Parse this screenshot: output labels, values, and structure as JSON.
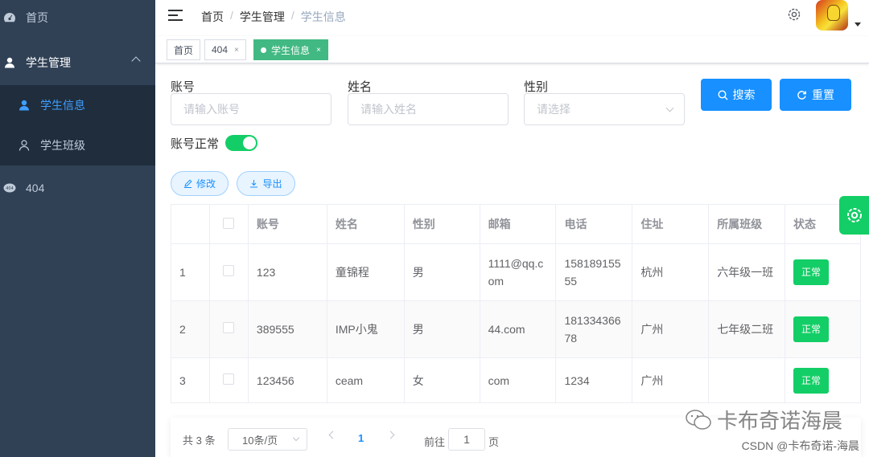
{
  "sidebar": {
    "home": "首页",
    "student_mgmt": "学生管理",
    "student_info": "学生信息",
    "student_class": "学生班级",
    "not_found": "404"
  },
  "navbar": {
    "breadcrumb": [
      "首页",
      "学生管理",
      "学生信息"
    ],
    "sep": "/"
  },
  "tags": {
    "home": "首页",
    "not_found": "404",
    "current": "学生信息",
    "close": "×"
  },
  "search": {
    "account_label": "账号",
    "account_placeholder": "请输入账号",
    "name_label": "姓名",
    "name_placeholder": "请输入姓名",
    "gender_label": "性别",
    "gender_placeholder": "请选择",
    "status_label": "账号正常",
    "status_on": true,
    "search_button": "搜索",
    "reset_button": "重置"
  },
  "actions": {
    "edit": "修改",
    "export": "导出"
  },
  "table": {
    "headers": [
      "账号",
      "姓名",
      "性别",
      "邮箱",
      "电话",
      "住址",
      "所属班级",
      "状态"
    ],
    "rows": [
      {
        "index": "1",
        "account": "123",
        "name": "童锦程",
        "gender": "男",
        "email": "1111@qq.com",
        "phone": "15818915555",
        "address": "杭州",
        "class": "六年级一班",
        "status": "正常"
      },
      {
        "index": "2",
        "account": "389555",
        "name": "IMP小鬼",
        "gender": "男",
        "email": "44.com",
        "phone": "18133436678",
        "address": "广州",
        "class": "七年级二班",
        "status": "正常"
      },
      {
        "index": "3",
        "account": "123456",
        "name": "ceam",
        "gender": "女",
        "email": "com",
        "phone": "1234",
        "address": "广州",
        "class": "",
        "status": "正常"
      }
    ]
  },
  "pagination": {
    "total": "共 3 条",
    "page_size": "10条/页",
    "current": "1",
    "goto_prefix": "前往",
    "goto_value": "1",
    "goto_suffix": "页"
  },
  "watermark": {
    "line1": "卡布奇诺海晨",
    "line2": "CSDN @卡布奇诺-海晨"
  },
  "colors": {
    "sidebar_bg": "#304156",
    "primary": "#1890ff",
    "success": "#13ce66",
    "tag_active": "#42b983"
  }
}
